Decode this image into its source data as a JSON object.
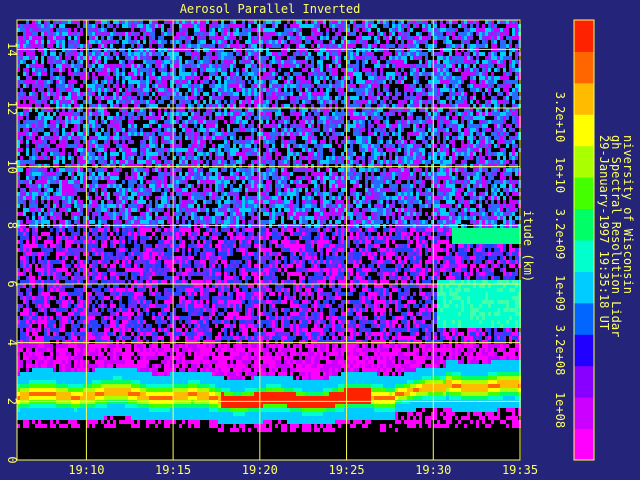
{
  "chart_data": {
    "type": "heatmap",
    "title": "Aerosol Parallel Inverted",
    "ylabel": "itude (km)",
    "x_ticks": [
      "19:10",
      "19:15",
      "19:20",
      "19:25",
      "19:30",
      "19:35"
    ],
    "y_ticks": [
      0,
      2,
      4,
      6,
      8,
      10,
      12,
      14
    ],
    "ylim": [
      0,
      15
    ],
    "xlim": [
      "19:06",
      "19:35"
    ],
    "grid": true,
    "colorbar": {
      "ticks": [
        "1e+08",
        "3.2e+08",
        "1e+09",
        "3.2e+09",
        "1e+10",
        "3.2e+10"
      ],
      "colors": [
        "#ff00ff",
        "#cc00ff",
        "#8800ff",
        "#2200ff",
        "#0066ff",
        "#00ccff",
        "#00ffcc",
        "#00ff66",
        "#44ff00",
        "#aaff00",
        "#ffff00",
        "#ffbb00",
        "#ff6600",
        "#ff2200"
      ]
    },
    "layers": {
      "ground_top_km": 1.1,
      "aerosol_layer_km": [
        1.4,
        3.0
      ],
      "cloud_19_30_km": [
        4.6,
        6.2
      ],
      "cloud_high_km": [
        7.4,
        8.0
      ]
    }
  },
  "caption": {
    "line1": "niversity of Wisconsin",
    "line2": "gh Spectral Resolution Lidar",
    "line3": "29-January-1997 19:35:18 UT"
  }
}
